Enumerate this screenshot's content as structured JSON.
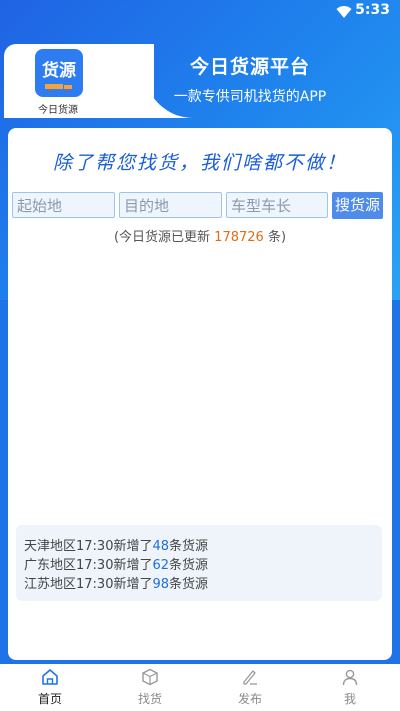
{
  "status_bar": {
    "time": "5:33"
  },
  "header": {
    "logo_text": "货源",
    "logo_caption": "今日货源",
    "title": "今日货源平台",
    "subtitle": "一款专供司机找货的APP"
  },
  "main": {
    "slogan": "除了帮您找货，我们啥都不做！",
    "search": {
      "origin_placeholder": "起始地",
      "destination_placeholder": "目的地",
      "vehicle_placeholder": "车型车长",
      "button_label": "搜货源"
    },
    "update_prefix": "(今日货源已更新",
    "update_count": "178726",
    "update_suffix": "条)",
    "news": [
      {
        "prefix": "天津地区17:30新增了",
        "count": "48",
        "suffix": "条货源"
      },
      {
        "prefix": "广东地区17:30新增了",
        "count": "62",
        "suffix": "条货源"
      },
      {
        "prefix": "江苏地区17:30新增了",
        "count": "98",
        "suffix": "条货源"
      }
    ]
  },
  "bottom_nav": [
    {
      "label": "首页",
      "icon": "home-icon",
      "active": true
    },
    {
      "label": "找货",
      "icon": "box-icon",
      "active": false
    },
    {
      "label": "发布",
      "icon": "publish-icon",
      "active": false
    },
    {
      "label": "我",
      "icon": "profile-icon",
      "active": false
    }
  ],
  "colors": {
    "primary": "#1f73e8",
    "accent_orange": "#e66b14",
    "count_blue": "#1e6fd8"
  }
}
